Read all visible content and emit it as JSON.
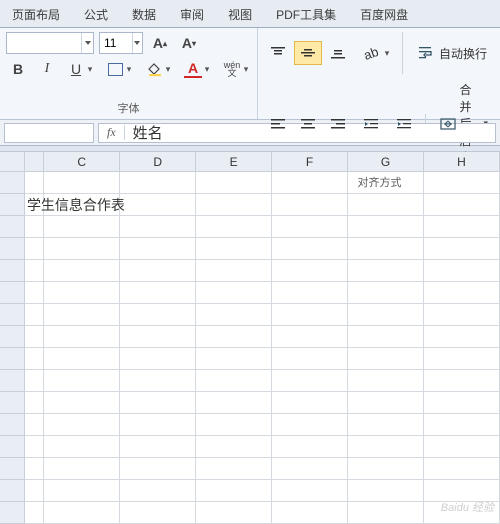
{
  "tabs": {
    "layout": "页面布局",
    "formula": "公式",
    "data": "数据",
    "review": "审阅",
    "view": "视图",
    "pdf": "PDF工具集",
    "baidu": "百度网盘"
  },
  "font": {
    "name": "",
    "size": "11",
    "bold": "B",
    "italic": "I",
    "underline": "U",
    "wen": "wén"
  },
  "align": {
    "wrap": "自动换行",
    "merge": "合并后居中"
  },
  "groups": {
    "font": "字体",
    "align": "对齐方式"
  },
  "bar": {
    "name": "",
    "formula": "姓名",
    "fx": "fx"
  },
  "cols": {
    "c": "C",
    "d": "D",
    "e": "E",
    "f": "F",
    "g": "G",
    "h": "H"
  },
  "cells": {
    "r1c1": "",
    "title": "学生信息合作表",
    "r3": "",
    "r4": "",
    "r5": ""
  },
  "wm": "Baidu 经验"
}
